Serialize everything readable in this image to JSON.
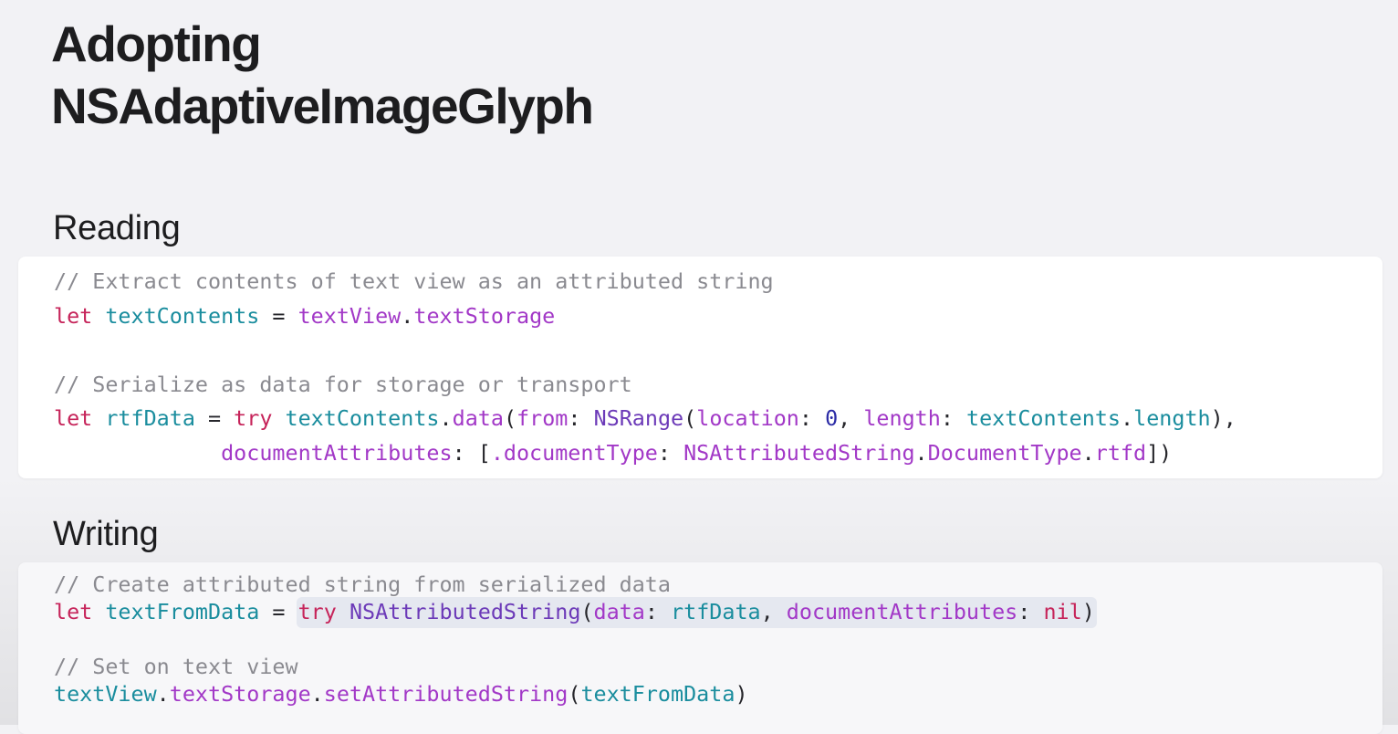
{
  "title": {
    "line1": "Adopting",
    "line2": "NSAdaptiveImageGlyph"
  },
  "sections": {
    "reading": {
      "heading": "Reading",
      "code": {
        "comment1": "// Extract contents of text view as an attributed string",
        "l2": {
          "kw": "let",
          "name": "textContents",
          "eq": " = ",
          "obj": "textView",
          "dot": ".",
          "prop": "textStorage"
        },
        "comment2": "// Serialize as data for storage or transport",
        "l5": {
          "kw": "let",
          "name": "rtfData",
          "eq": " = ",
          "try": "try",
          "obj": "textContents",
          "dot1": ".",
          "method": "data",
          "open": "(",
          "from": "from",
          "colon1": ": ",
          "type": "NSRange",
          "open2": "(",
          "location": "location",
          "colon2": ": ",
          "zero": "0",
          "comma1": ", ",
          "length": "length",
          "colon3": ": ",
          "obj2": "textContents",
          "dot2": ".",
          "length2": "length",
          "close": "),"
        },
        "l6": {
          "indent": "             ",
          "docAttrs": "documentAttributes",
          "colon": ": [",
          "dotType": ".documentType",
          "colon2": ": ",
          "nsas": "NSAttributedString",
          "dot1": ".",
          "docType": "DocumentType",
          "dot2": ".",
          "rtfd": "rtfd",
          "close": "])"
        }
      }
    },
    "writing": {
      "heading": "Writing",
      "code": {
        "comment1": "// Create attributed string from serialized data",
        "l2": {
          "kw": "let",
          "name": "textFromData",
          "eq": " = ",
          "try": "try",
          "type": "NSAttributedString",
          "open": "(",
          "dataLabel": "data",
          "colon1": ": ",
          "rtfData": "rtfData",
          "comma": ", ",
          "docAttrs": "documentAttributes",
          "colon2": ": ",
          "nil": "nil",
          "close": ")"
        },
        "comment2": "// Set on text view",
        "l5": {
          "obj": "textView",
          "dot1": ".",
          "prop": "textStorage",
          "dot2": ".",
          "method": "setAttributedString",
          "open": "(",
          "arg": "textFromData",
          "close": ")"
        }
      }
    }
  },
  "colors": {
    "background": "#f2f2f5",
    "keyword": "#c6245a",
    "identifier": "#1a8d9e",
    "property": "#a238c7",
    "type": "#6c3ab8",
    "number": "#2c2ca6",
    "comment": "#8a8a90"
  }
}
